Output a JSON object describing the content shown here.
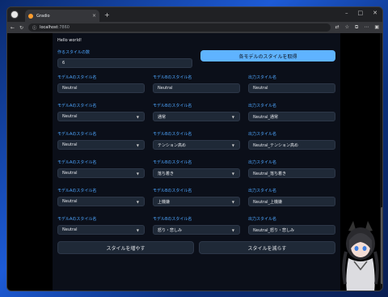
{
  "browser": {
    "tab_title": "Gradio",
    "tab_close": "×",
    "new_tab": "+",
    "url_host": "localhost",
    "url_port": ":7860"
  },
  "page": {
    "greeting": "Hello world!",
    "count_label": "作るスタイルの数",
    "count_value": "6",
    "fetch_button": "各モデルのスタイルを取得",
    "increase_button": "スタイルを増やす",
    "decrease_button": "スタイルを減らす",
    "model_a_label": "モデルAのスタイル名",
    "model_b_label": "モデルBのスタイル名",
    "output_label": "出力スタイル名",
    "rows": [
      {
        "a": "Neutral",
        "b": "Neutral",
        "out": "Neutral"
      },
      {
        "a": "Neutral",
        "b": "通常",
        "out": "Neutral_通常"
      },
      {
        "a": "Neutral",
        "b": "テンション高め",
        "out": "Neutral_テンション高め"
      },
      {
        "a": "Neutral",
        "b": "落ち着き",
        "out": "Neutral_落ち着き"
      },
      {
        "a": "Neutral",
        "b": "上機嫌",
        "out": "Neutral_上機嫌"
      },
      {
        "a": "Neutral",
        "b": "怒り・悲しみ",
        "out": "Neutral_怒り・悲しみ"
      }
    ]
  }
}
